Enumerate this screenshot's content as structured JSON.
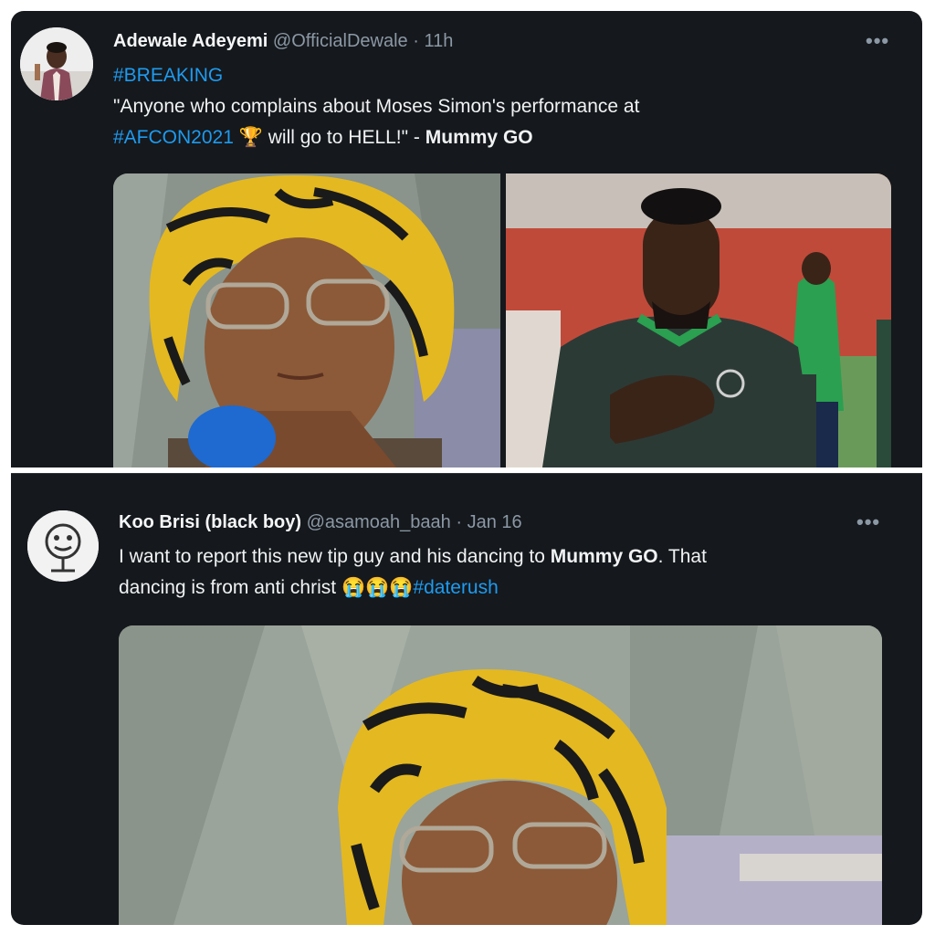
{
  "tweet1": {
    "display_name": "Adewale Adeyemi",
    "handle": "@OfficialDewale",
    "separator": " · ",
    "time": "11h",
    "more_icon": "more-horizontal-icon",
    "line1": "#BREAKING",
    "line2": "\"Anyone who complains about Moses Simon's performance at",
    "hashtag": "#AFCON2021",
    "emoji": "🏆",
    "line3_rest": " will go to HELL!\" - ",
    "attribution": "Mummy GO"
  },
  "tweet2": {
    "display_name": "Koo Brisi (black boy)",
    "handle": "@asamoah_baah",
    "separator": " · ",
    "date": "Jan 16",
    "more_icon": "more-horizontal-icon",
    "text_a": "I want to report this new tip guy and his dancing to ",
    "bold_name": "Mummy GO",
    "text_b": ". That",
    "text_c": "dancing is from anti christ ",
    "emojis": "😭😭😭",
    "hashtag": "#daterush"
  },
  "colors": {
    "background": "#15181c",
    "hashtag": "#1d9bf0",
    "handle": "#8b98a5"
  }
}
